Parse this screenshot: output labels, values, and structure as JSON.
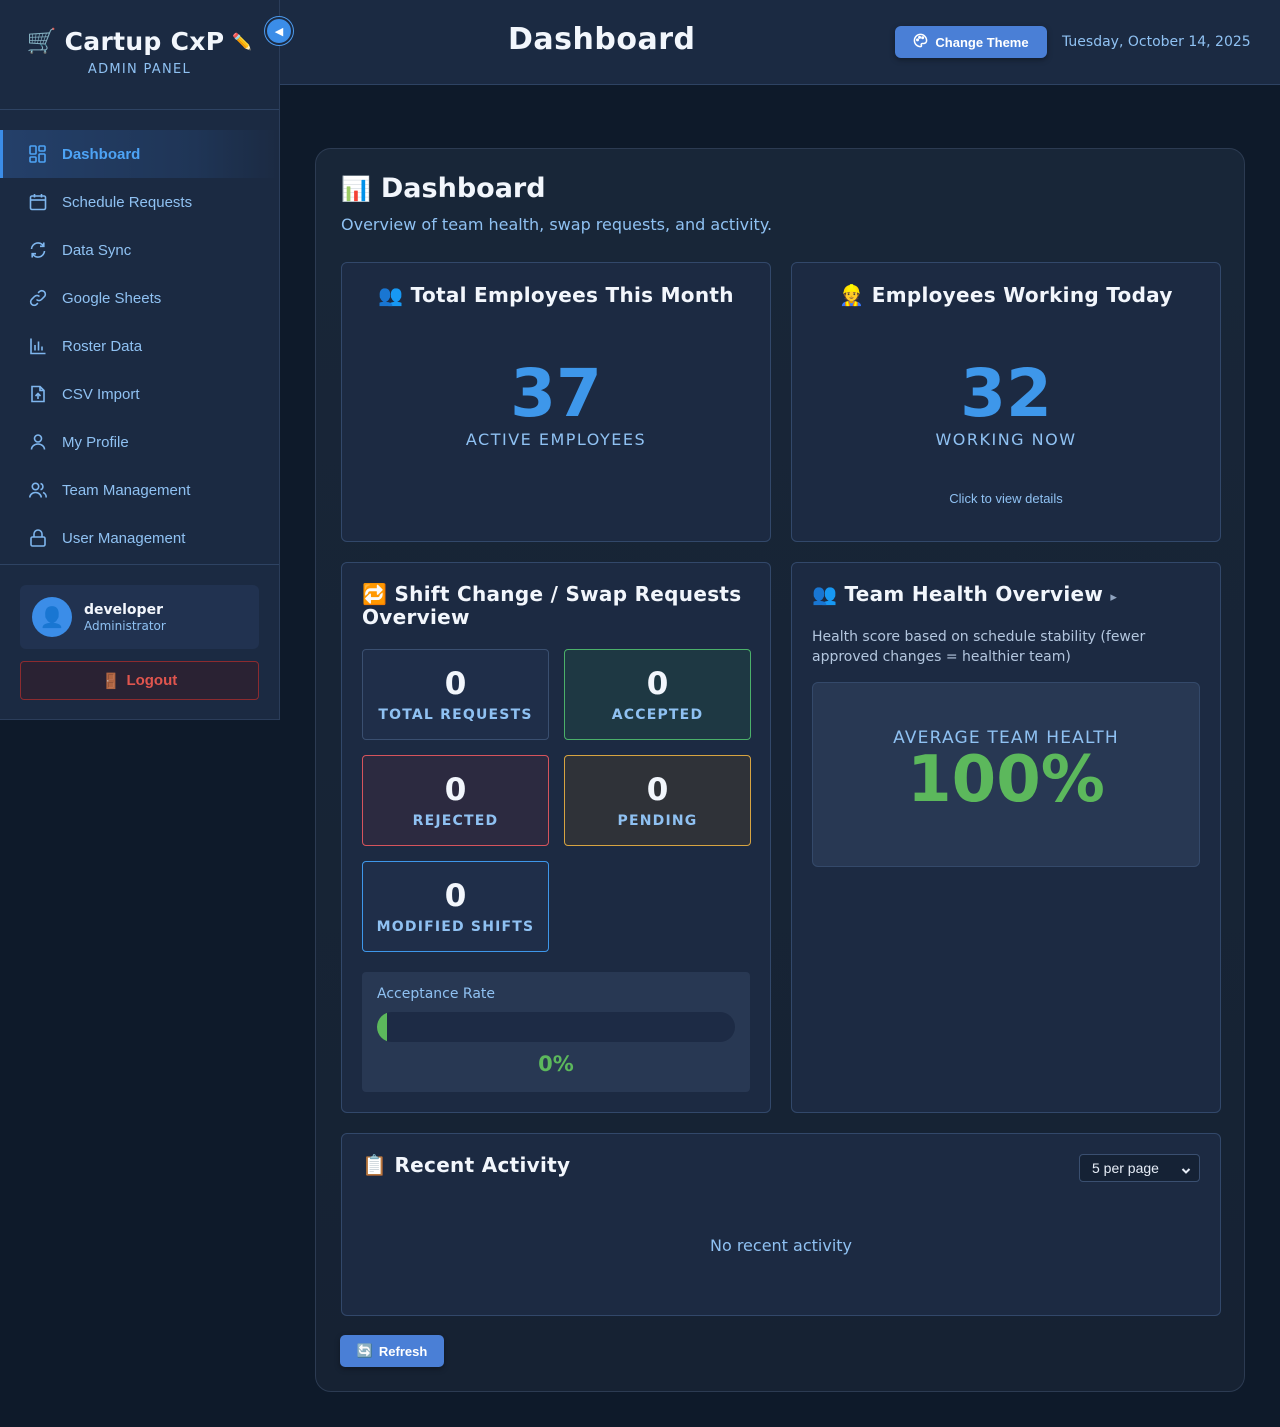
{
  "brand": {
    "title": "Cartup CxP",
    "subtitle": "ADMIN PANEL",
    "cart_icon": "🛒",
    "pencil_icon": "✏️",
    "collapse_icon": "◀"
  },
  "sidebar": {
    "items": [
      {
        "label": "Dashboard",
        "icon": "dashboard-icon",
        "active": true
      },
      {
        "label": "Schedule Requests",
        "icon": "calendar-icon",
        "active": false
      },
      {
        "label": "Data Sync",
        "icon": "sync-icon",
        "active": false
      },
      {
        "label": "Google Sheets",
        "icon": "link-icon",
        "active": false
      },
      {
        "label": "Roster Data",
        "icon": "bar-chart-icon",
        "active": false
      },
      {
        "label": "CSV Import",
        "icon": "file-upload-icon",
        "active": false
      },
      {
        "label": "My Profile",
        "icon": "user-icon",
        "active": false
      },
      {
        "label": "Team Management",
        "icon": "users-icon",
        "active": false
      },
      {
        "label": "User Management",
        "icon": "lock-icon",
        "active": false
      }
    ],
    "user": {
      "name": "developer",
      "role": "Administrator",
      "avatar_icon": "👤"
    },
    "logout": {
      "label": "Logout",
      "icon": "🚪"
    }
  },
  "topbar": {
    "title": "Dashboard",
    "theme_button": "Change Theme",
    "date": "Tuesday, October 14, 2025"
  },
  "main": {
    "heading_icon": "📊",
    "heading": "Dashboard",
    "description": "Overview of team health, swap requests, and activity.",
    "total_employees": {
      "icon": "👥",
      "title": "Total Employees This Month",
      "value": "37",
      "label": "ACTIVE EMPLOYEES"
    },
    "working_today": {
      "icon": "👷",
      "title": "Employees Working Today",
      "value": "32",
      "label": "WORKING NOW",
      "link": "Click to view details"
    },
    "swap": {
      "icon": "🔁",
      "title": "Shift Change / Swap Requests Overview",
      "stats": {
        "total": {
          "value": "0",
          "label": "TOTAL REQUESTS"
        },
        "accepted": {
          "value": "0",
          "label": "ACCEPTED"
        },
        "rejected": {
          "value": "0",
          "label": "REJECTED"
        },
        "pending": {
          "value": "0",
          "label": "PENDING"
        },
        "modified": {
          "value": "0",
          "label": "MODIFIED SHIFTS"
        }
      },
      "acceptance": {
        "label": "Acceptance Rate",
        "value_text": "0%",
        "fraction": 0
      }
    },
    "health": {
      "icon": "👥",
      "title": "Team Health Overview",
      "expand_icon": "▸",
      "description": "Health score based on schedule stability (fewer approved changes = healthier team)",
      "avg_label": "AVERAGE TEAM HEALTH",
      "avg_value": "100%"
    },
    "activity": {
      "icon": "📋",
      "title": "Recent Activity",
      "per_page": "5 per page",
      "empty": "No recent activity"
    },
    "refresh": {
      "label": "Refresh",
      "icon": "🔄"
    }
  },
  "colors": {
    "accent": "#3e97ea",
    "success": "#5cb85c",
    "danger": "#d6545c",
    "warning": "#d7a441",
    "button": "#4a7fd6"
  }
}
